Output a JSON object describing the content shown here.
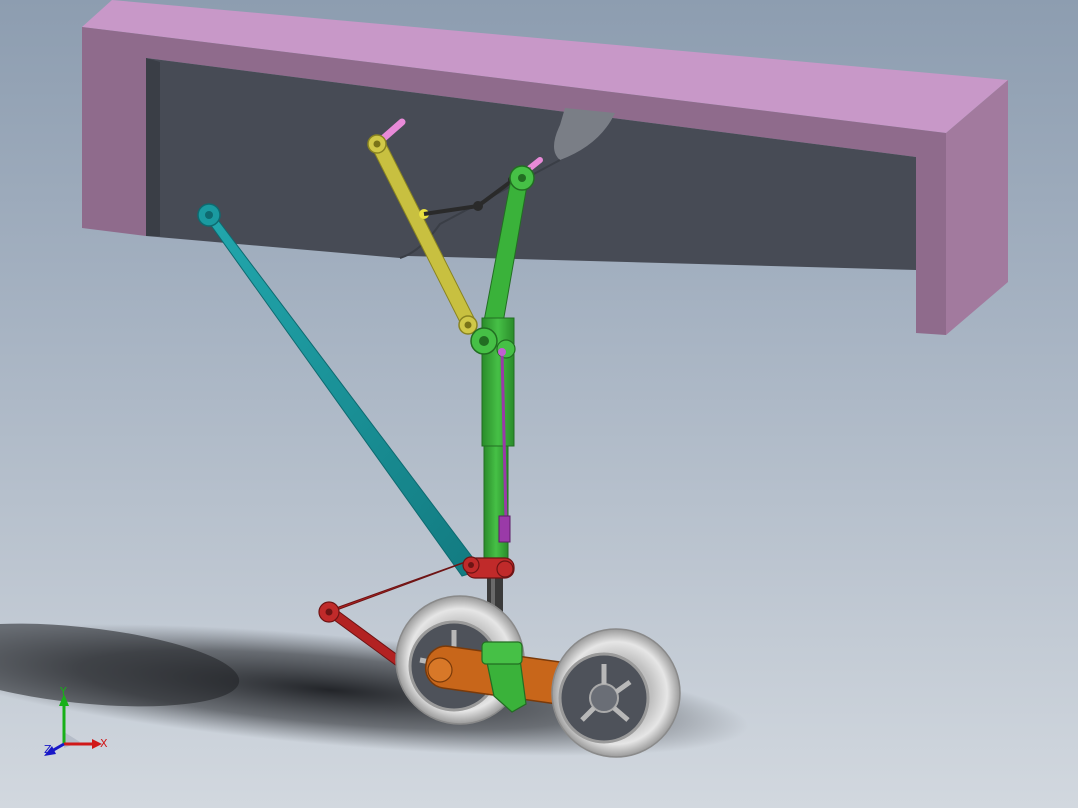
{
  "view": {
    "background_top": "#8d9db0",
    "background_bottom": "#d2d8df"
  },
  "colors": {
    "fuselage_top": "#c898c8",
    "fuselage_side": "#8c6a8c",
    "fuselage_dark": "#5a4058",
    "bay_interior": "#474b55",
    "drag_strut": "#1a9aa0",
    "upper_link": "#c8c040",
    "lock_link": "#2a2a2a",
    "main_strut": "#3ab23a",
    "actuator": "#9a3aa8",
    "torque_link": "#b22222",
    "bogie_beam": "#c8661a",
    "tire": "#dcdcdc",
    "axle": "#3a3a3a"
  },
  "triad": {
    "x_label": "X",
    "y_label": "Y",
    "z_label": "Z",
    "x_color": "#d01818",
    "y_color": "#18b018",
    "z_color": "#1818c8"
  }
}
